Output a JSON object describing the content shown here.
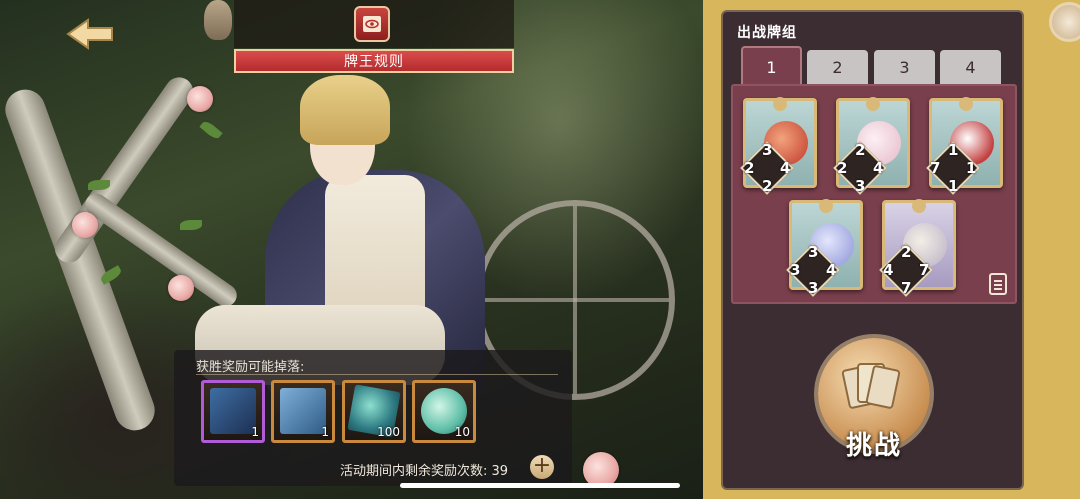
{
  "header": {
    "rules_label": "牌王规则"
  },
  "rewards": {
    "title": "获胜奖励可能掉落:",
    "items": [
      {
        "icon": "card-reward-icon",
        "count": "1"
      },
      {
        "icon": "card-reward-icon",
        "count": "1"
      },
      {
        "icon": "crystal-icon",
        "count": "100"
      },
      {
        "icon": "potion-icon",
        "count": "10"
      }
    ],
    "remaining_text": "活动期间内剩余奖励次数: 39"
  },
  "deck": {
    "title": "出战牌组",
    "tabs": [
      "1",
      "2",
      "3",
      "4"
    ],
    "active_tab": "1",
    "cards": [
      {
        "stats": [
          "3",
          "2",
          "4",
          "2"
        ]
      },
      {
        "stats": [
          "2",
          "2",
          "4",
          "3"
        ]
      },
      {
        "stats": [
          "1",
          "7",
          "1",
          "1"
        ]
      },
      {
        "stats": [
          "3",
          "3",
          "4",
          "3"
        ]
      },
      {
        "stats": [
          "2",
          "4",
          "7",
          "7"
        ]
      }
    ]
  },
  "challenge": {
    "label": "挑战"
  }
}
